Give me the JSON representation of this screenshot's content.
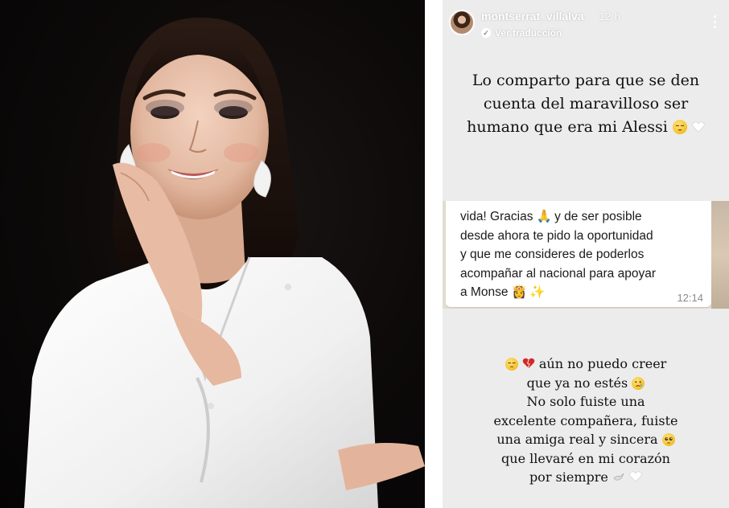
{
  "story": {
    "username": "montserrat_villalva",
    "time_ago": "12 h",
    "translate_label": "Ver traducción",
    "intro_lines": [
      "Lo comparto para que se den",
      "cuenta del maravilloso ser",
      "humano que era mi Alessi"
    ],
    "chat": {
      "lines": [
        "vida! Gracias",
        "y de ser posible",
        "desde ahora te pido la oportunidad",
        "y que me consideres de poderlos",
        "acompañar al nacional para apoyar",
        "a Monse"
      ],
      "time": "12:14"
    },
    "outro_lines": [
      "aún no puedo creer",
      "que ya no estés",
      "No solo fuiste una",
      "excelente compañera, fuiste",
      "una amiga real y sincera",
      "que llevaré en mi corazón",
      "por siempre"
    ]
  },
  "colors": {
    "story_bg": "#ececec",
    "photo_bg": "#0c0909",
    "text": "#111111"
  }
}
